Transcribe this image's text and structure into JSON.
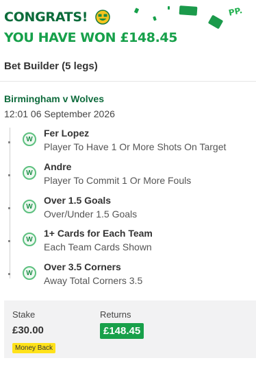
{
  "header": {
    "congrats_text": "CONGRATS!",
    "won_prefix": "YOU HAVE WON",
    "won_amount": "£148.45",
    "brand_logo": "PP."
  },
  "bet": {
    "type_label": "Bet Builder (5 legs)"
  },
  "event": {
    "name": "Birmingham v Wolves",
    "datetime": "12:01 06 September 2026"
  },
  "legs": [
    {
      "result": "W",
      "title": "Fer Lopez",
      "market": "Player To Have 1 Or More Shots On Target"
    },
    {
      "result": "W",
      "title": "Andre",
      "market": "Player To Commit 1 Or More Fouls"
    },
    {
      "result": "W",
      "title": "Over 1.5 Goals",
      "market": "Over/Under 1.5 Goals"
    },
    {
      "result": "W",
      "title": "1+ Cards for Each Team",
      "market": "Each Team Cards Shown"
    },
    {
      "result": "W",
      "title": "Over 3.5 Corners",
      "market": "Away Total Corners 3.5"
    }
  ],
  "summary": {
    "stake_label": "Stake",
    "stake_value": "£30.00",
    "returns_label": "Returns",
    "returns_value": "£148.45",
    "money_back_label": "Money Back"
  },
  "colors": {
    "brand_green": "#16a04a",
    "dark_green": "#0b6b3a",
    "money_back_yellow": "#ffe21a"
  }
}
